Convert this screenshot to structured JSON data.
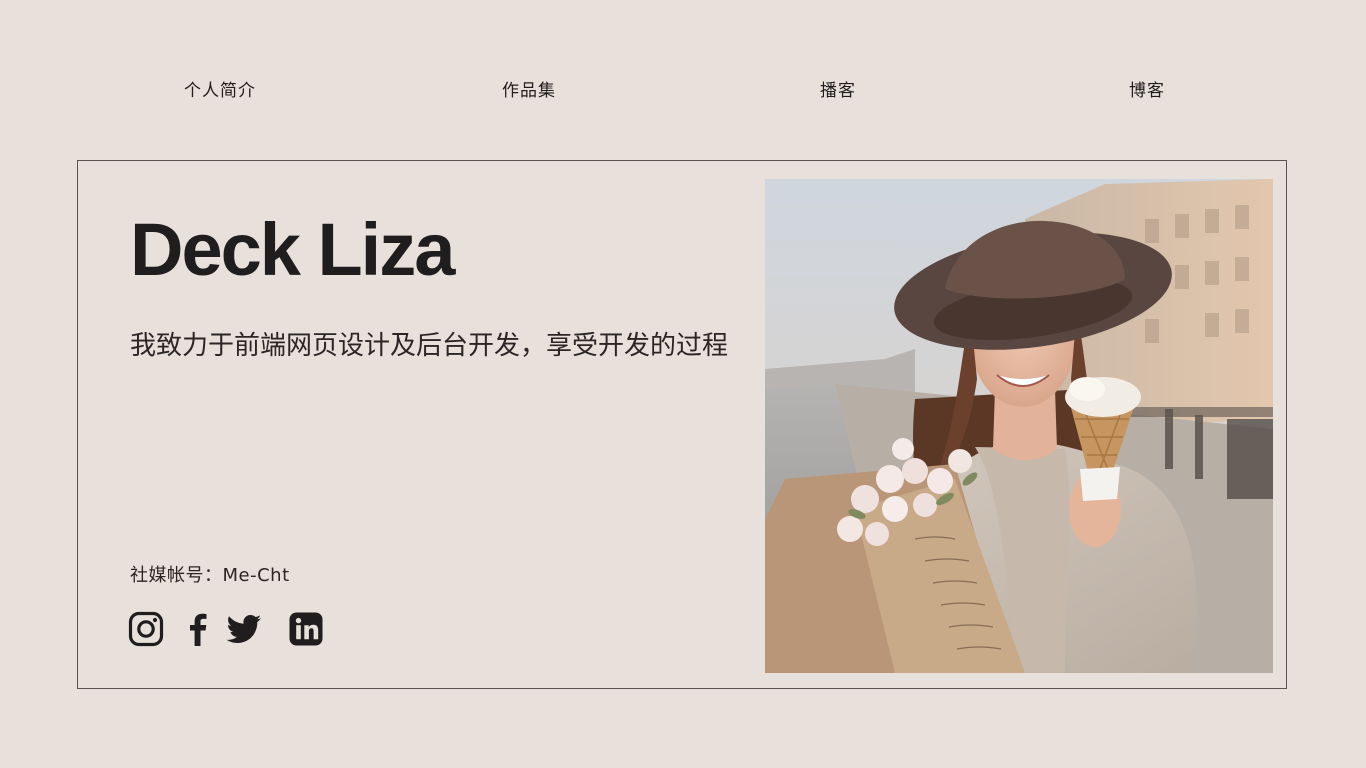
{
  "nav": {
    "items": [
      {
        "label": "个人简介"
      },
      {
        "label": "作品集"
      },
      {
        "label": "播客"
      },
      {
        "label": "博客"
      }
    ]
  },
  "hero": {
    "name": "Deck Liza",
    "tagline": "我致力于前端网页设计及后台开发，享受开发的过程",
    "social_label": "社媒帐号：Me-Cht",
    "social_icons": [
      "instagram-icon",
      "facebook-icon",
      "twitter-icon",
      "linkedin-icon"
    ]
  },
  "colors": {
    "background": "#e8e0da",
    "text": "#1f1d1d",
    "border": "#5a5350"
  }
}
